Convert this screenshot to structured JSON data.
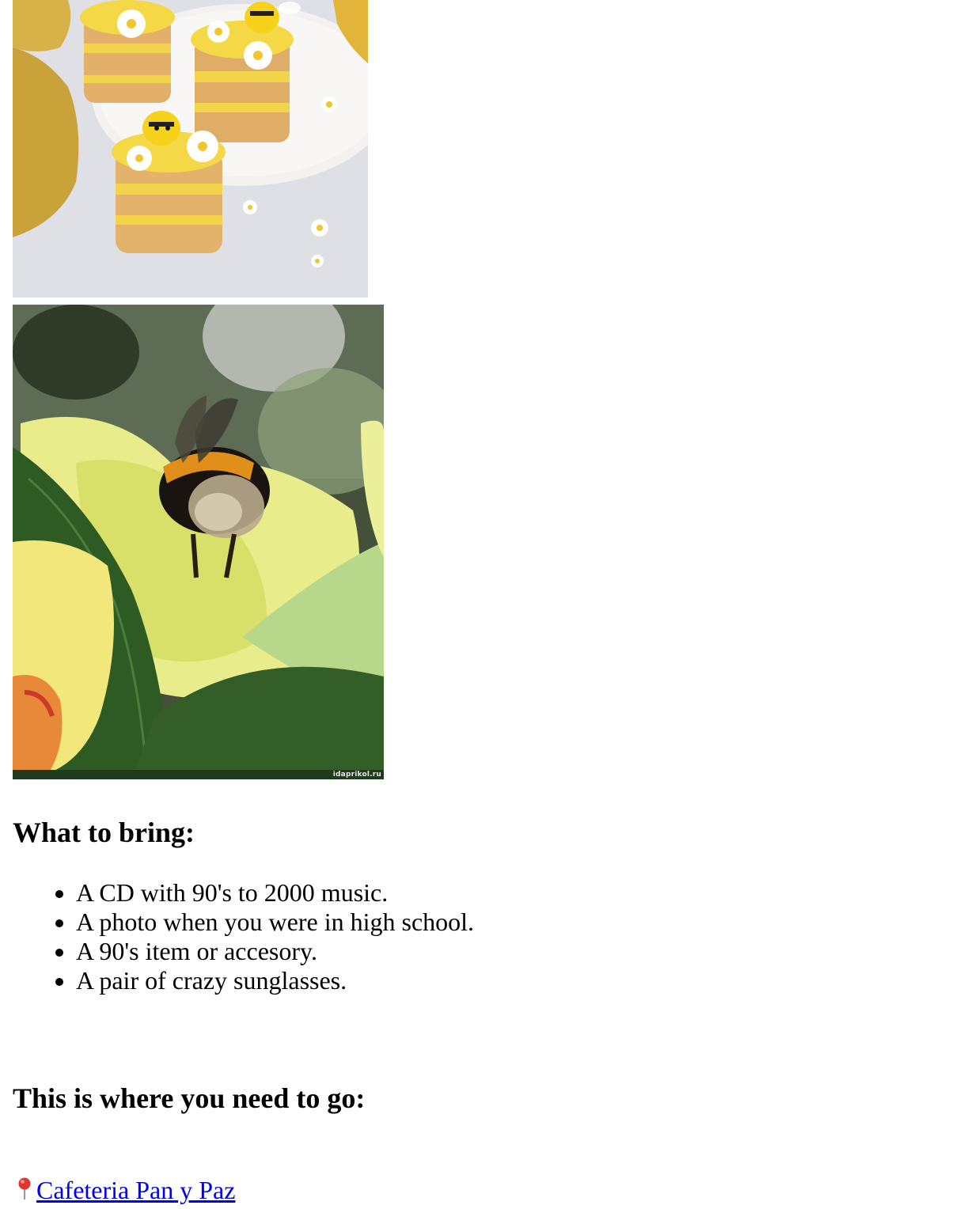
{
  "images": {
    "cupcakes": {
      "icon": "cupcakes-with-bees-photo"
    },
    "bee": {
      "icon": "bumblebee-on-flower-photo",
      "watermark": "idaprikol.ru"
    }
  },
  "bring_section": {
    "heading": "What to bring:",
    "items": [
      "A CD with 90's to 2000 music.",
      "A photo when you were in high school.",
      "A 90's item or accesory.",
      "A pair of crazy sunglasses."
    ]
  },
  "location_section": {
    "heading": "This is where you need to go:",
    "link_label": "Cafeteria Pan y Paz",
    "link_icon": "round-pushpin-icon"
  },
  "colors": {
    "link": "#0000ee",
    "text": "#000000",
    "background": "#ffffff"
  }
}
